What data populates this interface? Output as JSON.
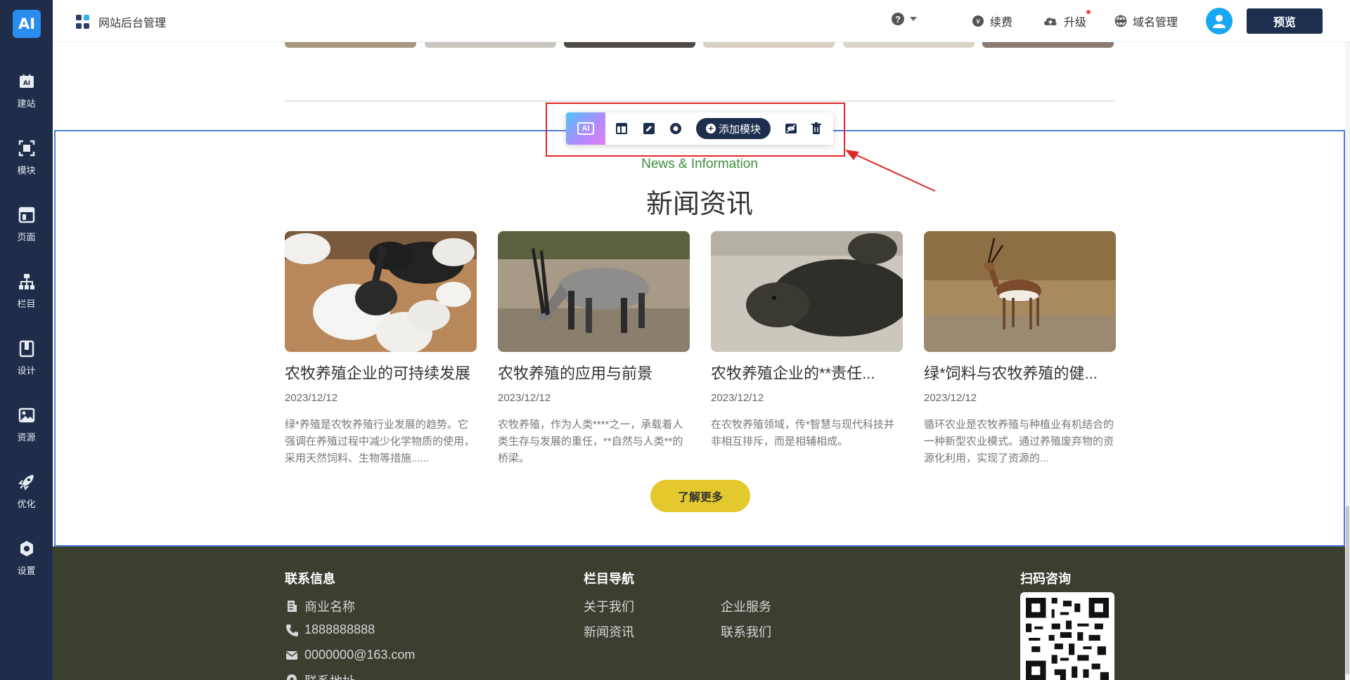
{
  "sidebar": {
    "logo": "AI",
    "items": [
      {
        "label": "建站",
        "icon": "ai-build-icon"
      },
      {
        "label": "模块",
        "icon": "module-icon"
      },
      {
        "label": "页面",
        "icon": "page-icon"
      },
      {
        "label": "栏目",
        "icon": "sitemap-icon"
      },
      {
        "label": "设计",
        "icon": "design-icon"
      },
      {
        "label": "资源",
        "icon": "image-resource-icon"
      },
      {
        "label": "优化",
        "icon": "rocket-icon"
      },
      {
        "label": "设置",
        "icon": "settings-icon"
      }
    ]
  },
  "topbar": {
    "title": "网站后台管理",
    "help": "?",
    "renew": "续费",
    "upgrade": "升级",
    "domain": "域名管理",
    "preview": "预览"
  },
  "toolbar": {
    "ai": "AI",
    "add_module": "添加模块"
  },
  "news": {
    "en_title": "News & Information",
    "cn_title": "新闻资讯",
    "items": [
      {
        "title": "农牧养殖企业的可持续发展",
        "date": "2023/12/12",
        "desc": "绿*养殖是农牧养殖行业发展的趋势。它强调在养殖过程中减少化学物质的使用，采用天然饲料、生物等措施......"
      },
      {
        "title": "农牧养殖的应用与前景",
        "date": "2023/12/12",
        "desc": "农牧养殖，作为人类****之一，承载着人类生存与发展的重任，**自然与人类**的桥梁。"
      },
      {
        "title": "农牧养殖企业的**责任...",
        "date": "2023/12/12",
        "desc": "在农牧养殖领域，传*智慧与现代科技并非相互排斥，而是相辅相成。"
      },
      {
        "title": "绿*饲料与农牧养殖的健...",
        "date": "2023/12/12",
        "desc": "循环农业是农牧养殖与种植业有机结合的一种新型农业模式。通过养殖废弃物的资源化利用，实现了资源的..."
      }
    ],
    "more": "了解更多"
  },
  "footer": {
    "contact_head": "联系信息",
    "company": "商业名称",
    "phone": "1888888888",
    "email": "0000000@163.com",
    "address": "联系地址",
    "nav_head": "栏目导航",
    "nav": [
      "关于我们",
      "企业服务",
      "新闻资讯",
      "联系我们"
    ],
    "qr_head": "扫码咨询"
  },
  "colors": {
    "sidebar": "#1f2d4a",
    "accent_blue": "#4a7fd6",
    "footer": "#3a3f30",
    "more_button": "#e3c82e",
    "english_title": "#3f8f3f"
  }
}
